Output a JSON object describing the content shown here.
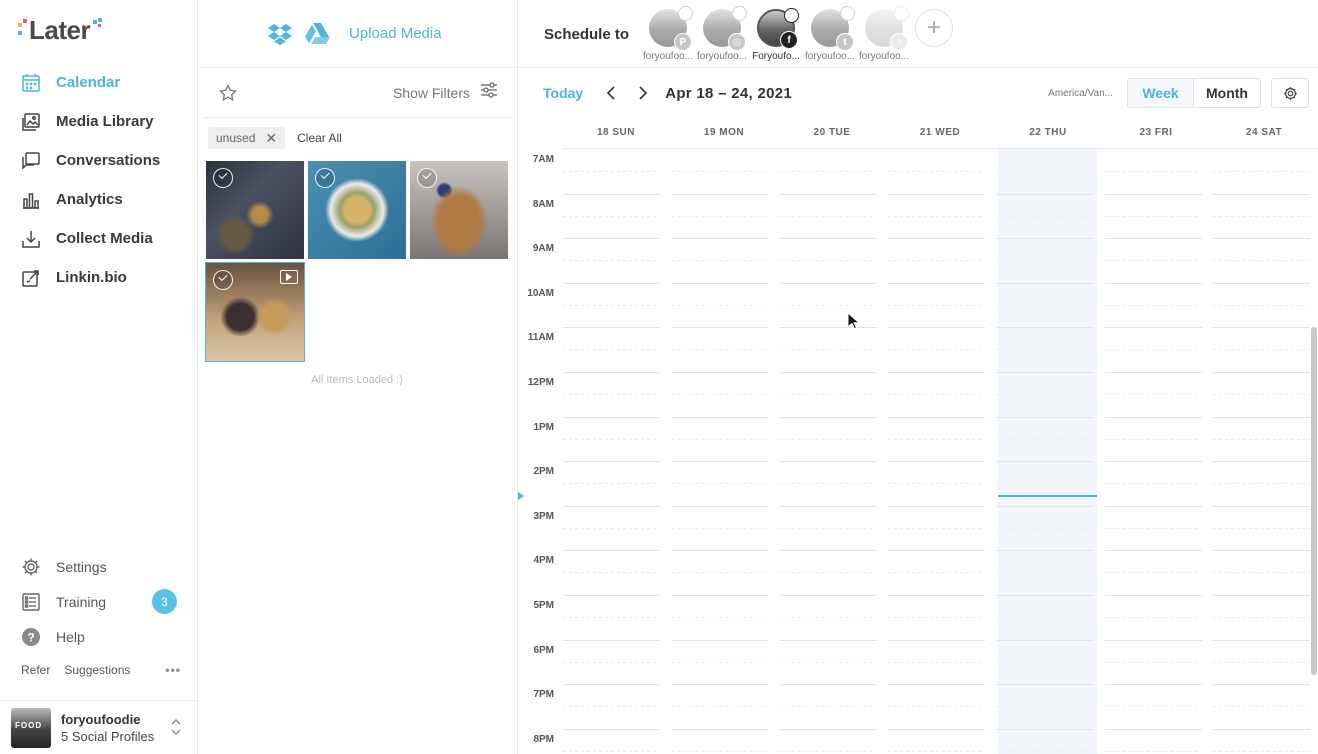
{
  "app": {
    "logo": "Later"
  },
  "sidebar": {
    "nav": [
      {
        "label": "Calendar",
        "icon": "calendar-icon",
        "active": true
      },
      {
        "label": "Media Library",
        "icon": "image-icon"
      },
      {
        "label": "Conversations",
        "icon": "chat-icon"
      },
      {
        "label": "Analytics",
        "icon": "bar-chart-icon"
      },
      {
        "label": "Collect Media",
        "icon": "download-icon"
      },
      {
        "label": "Linkin.bio",
        "icon": "link-edit-icon"
      }
    ],
    "bottom": [
      {
        "label": "Settings",
        "icon": "gear-icon"
      },
      {
        "label": "Training",
        "icon": "checklist-icon",
        "badge": "3"
      },
      {
        "label": "Help",
        "icon": "help-icon"
      }
    ],
    "refer": "Refer",
    "suggestions": "Suggestions",
    "more": "•••",
    "profile": {
      "name": "foryoufoodie",
      "subtitle": "5 Social Profiles"
    }
  },
  "media": {
    "upload_label": "Upload Media",
    "show_filters": "Show Filters",
    "filter_tag": "unused",
    "clear_all": "Clear All",
    "loaded_text": "All Items Loaded :)"
  },
  "calendar": {
    "schedule_label": "Schedule to",
    "profiles": [
      {
        "name": "foryoufoo...",
        "network": "P",
        "network_icon": "pinterest-icon"
      },
      {
        "name": "foryoufoo...",
        "network": "◎",
        "network_icon": "instagram-icon"
      },
      {
        "name": "Foryoufo...",
        "network": "f",
        "network_icon": "facebook-icon",
        "selected": true
      },
      {
        "name": "foryoufoo...",
        "network": "t",
        "network_icon": "twitter-icon"
      },
      {
        "name": "foryoufoo...",
        "network": "♪",
        "network_icon": "tiktok-icon"
      }
    ],
    "today_label": "Today",
    "range": "Apr 18 – 24, 2021",
    "timezone": "America/Van...",
    "views": {
      "week": "Week",
      "month": "Month",
      "active": "week"
    },
    "days": [
      "18 SUN",
      "19 MON",
      "20 TUE",
      "21 WED",
      "22 THU",
      "23 FRI",
      "24 SAT"
    ],
    "today_index": 4,
    "hours": [
      "7AM",
      "8AM",
      "9AM",
      "10AM",
      "11AM",
      "12PM",
      "1PM",
      "2PM",
      "3PM",
      "4PM",
      "5PM",
      "6PM",
      "7PM",
      "8PM"
    ],
    "accent": "#4cb5d8"
  }
}
